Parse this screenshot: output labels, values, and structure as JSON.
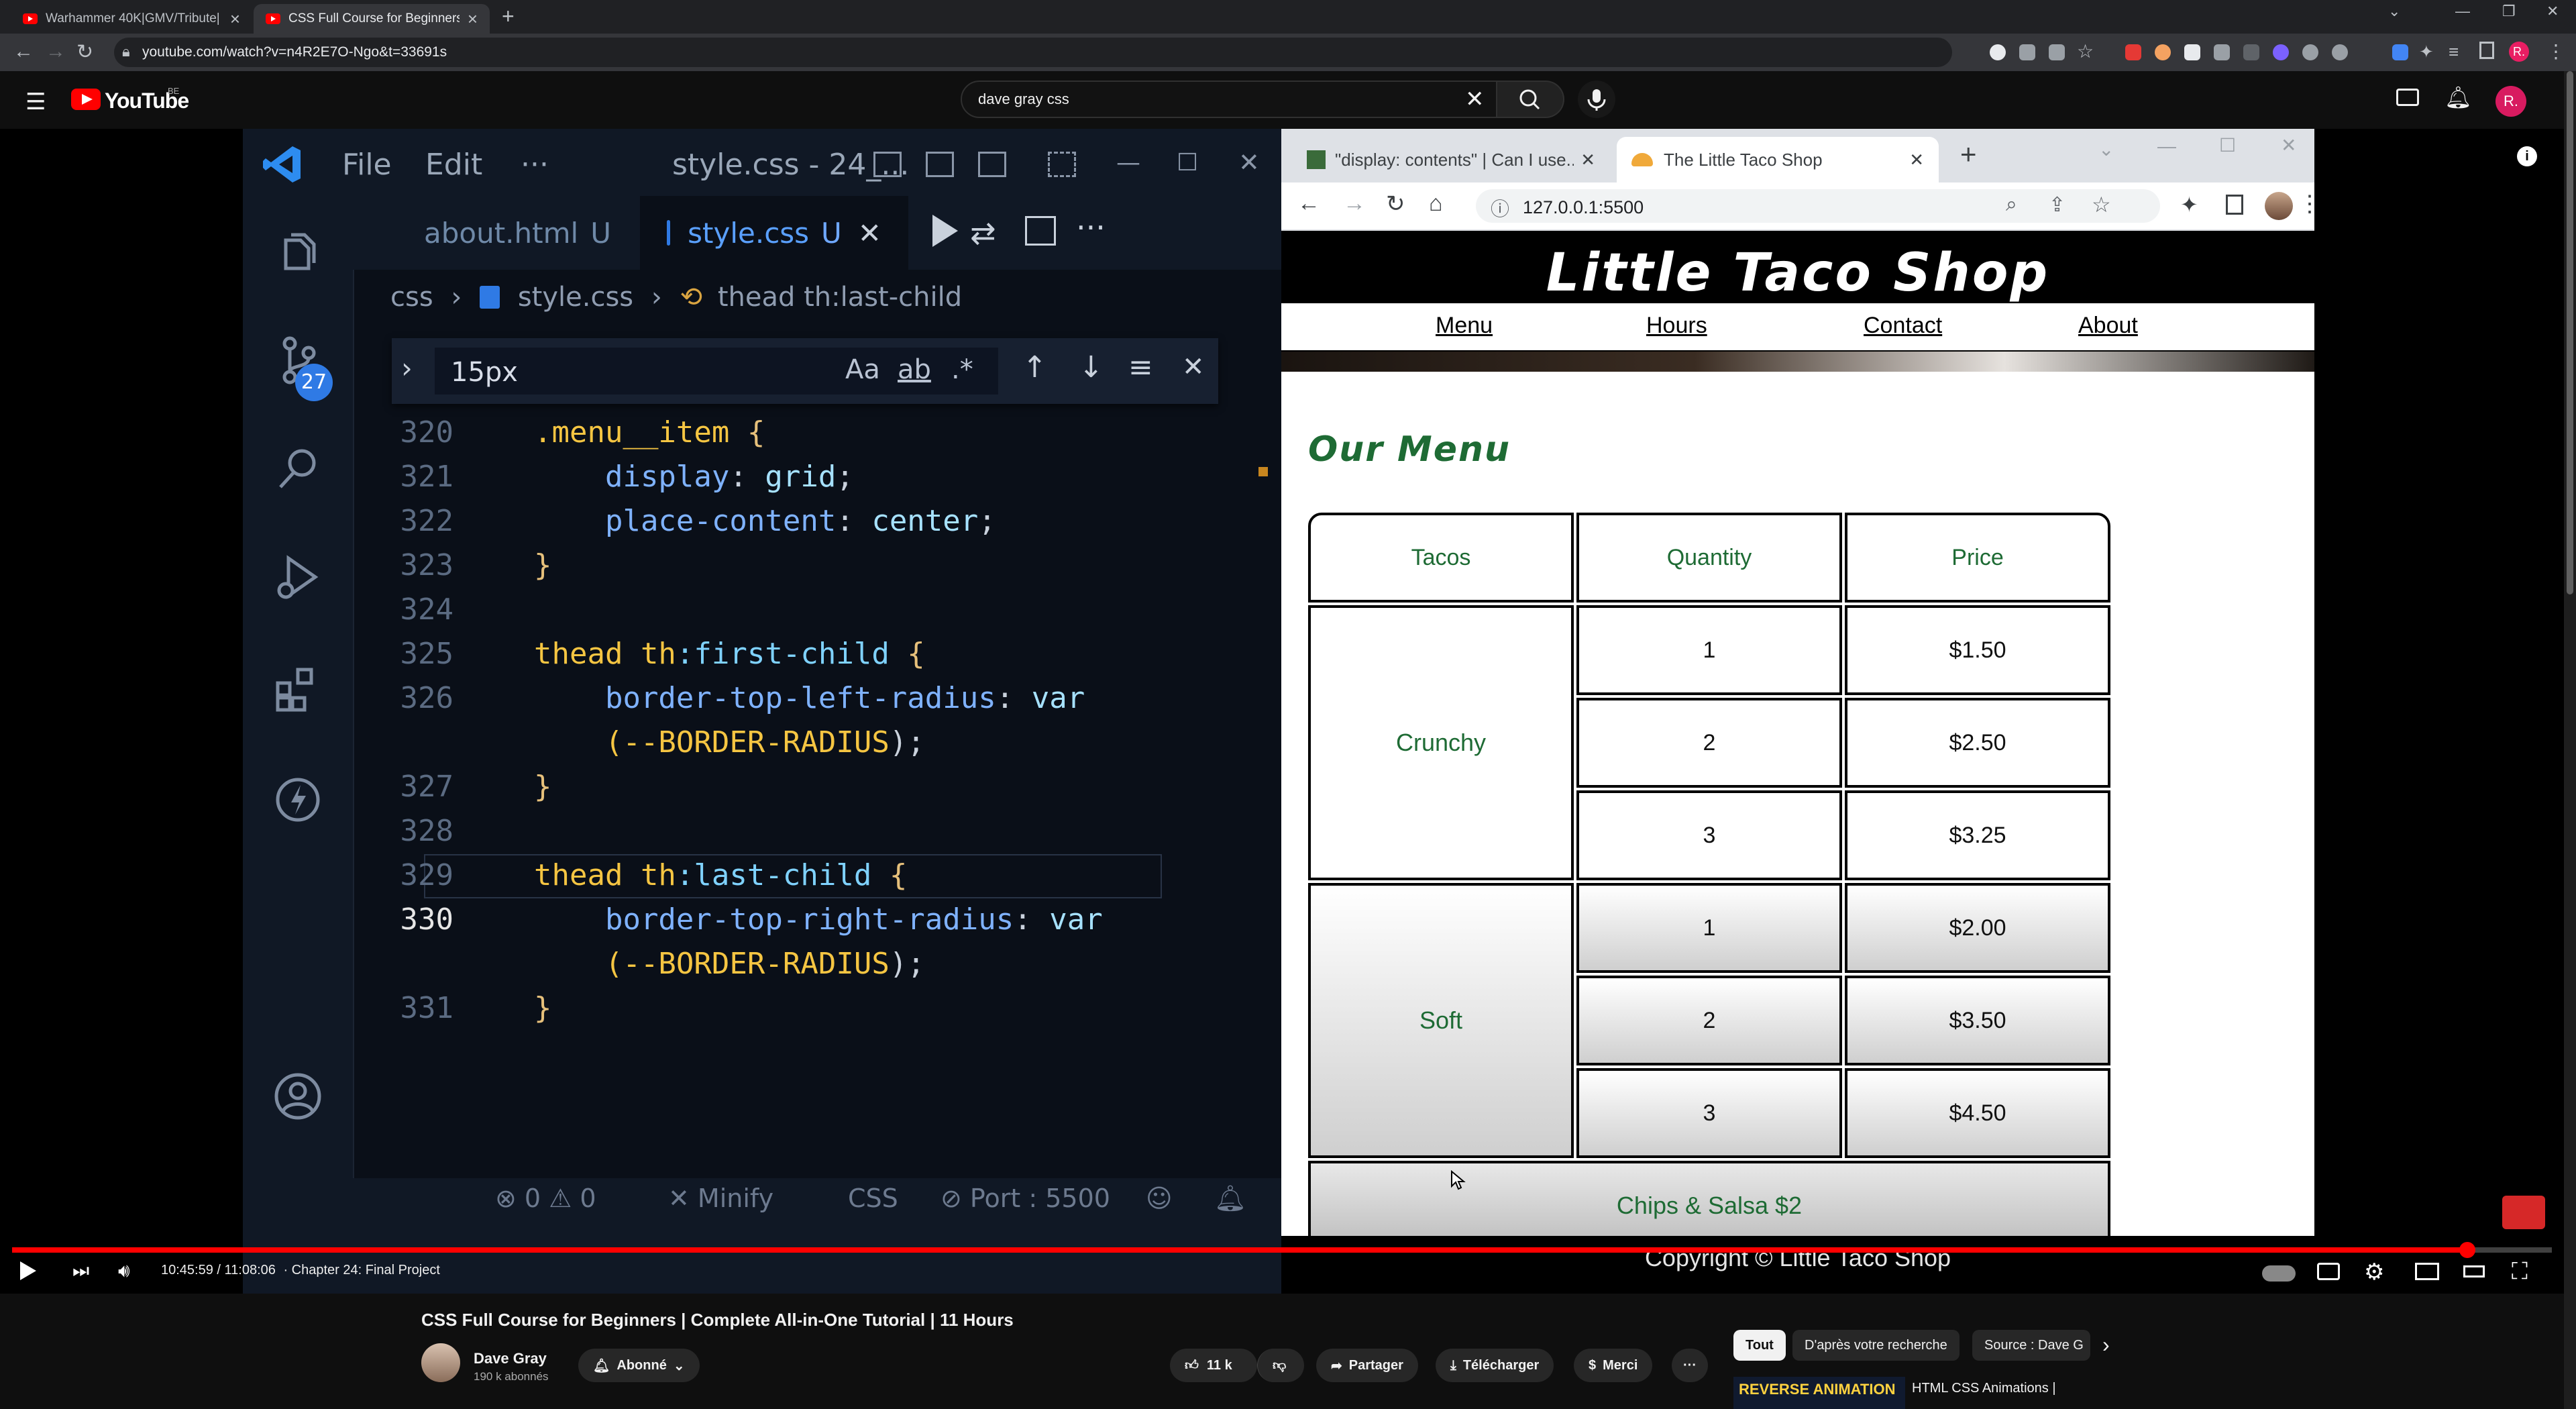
{
  "chrome": {
    "tabs": [
      {
        "title": "Warhammer 40K|GMV/Tribute|"
      },
      {
        "title": "CSS Full Course for Beginners | C"
      }
    ],
    "new_tab": "+",
    "url": "youtube.com/watch?v=n4R2E7O-Ngo&t=33691s",
    "profile_letter": "R."
  },
  "youtube": {
    "logo_text": "YouTube",
    "country": "BE",
    "search_value": "dave gray css",
    "profile_letter": "R."
  },
  "vscode": {
    "menu": [
      "File",
      "Edit",
      "···"
    ],
    "title": "style.css - 24_...",
    "scm_badge": "27",
    "tabs": [
      {
        "name": "about.html",
        "status": "U"
      },
      {
        "name": "style.css",
        "status": "U"
      }
    ],
    "breadcrumb": [
      "css",
      "style.css",
      "thead th:last-child"
    ],
    "find": {
      "value": "15px",
      "case": "Aa",
      "word": "ab",
      "regex": ".*"
    },
    "lines": [
      {
        "n": "320",
        "code": [
          [
            ".menu__item",
            "sel"
          ],
          [
            " {",
            "brace"
          ]
        ]
      },
      {
        "n": "321",
        "code": [
          [
            "    display",
            "prop"
          ],
          [
            ": ",
            "plain"
          ],
          [
            "grid",
            "val"
          ],
          [
            ";",
            "plain"
          ]
        ]
      },
      {
        "n": "322",
        "code": [
          [
            "    place-content",
            "prop"
          ],
          [
            ": ",
            "plain"
          ],
          [
            "center",
            "val"
          ],
          [
            ";",
            "plain"
          ]
        ]
      },
      {
        "n": "323",
        "code": [
          [
            "}",
            "brace"
          ]
        ]
      },
      {
        "n": "324",
        "code": []
      },
      {
        "n": "325",
        "code": [
          [
            "thead th",
            "sel"
          ],
          [
            ":first-child",
            "pseudo"
          ],
          [
            " {",
            "brace"
          ]
        ]
      },
      {
        "n": "326",
        "code": [
          [
            "    border-top-left-radius",
            "prop"
          ],
          [
            ": ",
            "plain"
          ],
          [
            "var",
            "val"
          ]
        ]
      },
      {
        "n": "",
        "code": [
          [
            "    (--BORDER-RADIUS",
            "sel"
          ],
          [
            ");",
            "plain"
          ]
        ]
      },
      {
        "n": "327",
        "code": [
          [
            "}",
            "brace"
          ]
        ]
      },
      {
        "n": "328",
        "code": []
      },
      {
        "n": "329",
        "code": [
          [
            "thead th",
            "sel"
          ],
          [
            ":last-child",
            "pseudo"
          ],
          [
            " {",
            "brace"
          ]
        ]
      },
      {
        "n": "330",
        "code": [
          [
            "    border-top-right-radius",
            "prop"
          ],
          [
            ": ",
            "plain"
          ],
          [
            "var",
            "val"
          ]
        ]
      },
      {
        "n": "",
        "code": [
          [
            "    (--BORDER-RADIUS",
            "sel"
          ],
          [
            ");",
            "plain"
          ]
        ]
      },
      {
        "n": "331",
        "code": [
          [
            "}",
            "brace"
          ]
        ]
      }
    ],
    "status": {
      "errors": "0",
      "warnings": "0",
      "minify": "Minify",
      "lang": "CSS",
      "port": "Port : 5500"
    }
  },
  "preview": {
    "tabs": [
      {
        "title": "\"display: contents\" | Can I use... S"
      },
      {
        "title": "The Little Taco Shop"
      }
    ],
    "url": "127.0.0.1:5500",
    "site_title": "Little Taco Shop",
    "nav": [
      "Menu",
      "Hours",
      "Contact",
      "About"
    ],
    "menu_heading": "Our Menu",
    "table": {
      "headers": [
        "Tacos",
        "Quantity",
        "Price"
      ],
      "groups": [
        {
          "name": "Crunchy",
          "rows": [
            [
              "1",
              "$1.50"
            ],
            [
              "2",
              "$2.50"
            ],
            [
              "3",
              "$3.25"
            ]
          ]
        },
        {
          "name": "Soft",
          "rows": [
            [
              "1",
              "$2.00"
            ],
            [
              "2",
              "$3.50"
            ],
            [
              "3",
              "$4.50"
            ]
          ]
        }
      ],
      "footer": "Chips & Salsa $2"
    },
    "copyright": "Copyright © Little Taco Shop"
  },
  "player": {
    "time": "10:45:59 / 11:08:06",
    "chapter": "· Chapter 24: Final Project",
    "progress": 0.9667
  },
  "video": {
    "title": "CSS Full Course for Beginners | Complete All-in-One Tutorial | 11 Hours",
    "channel": "Dave Gray",
    "subscribers": "190 k abonnés",
    "subscribe": "Abonné",
    "likes": "11 k",
    "share": "Partager",
    "download": "Télécharger",
    "thanks": "Merci",
    "more": "···"
  },
  "recommendations": {
    "chips": [
      "Tout",
      "D'après votre recherche",
      "Source : Dave G"
    ],
    "first_thumb": "REVERSE ANIMATION",
    "first_title": "HTML CSS Animations |"
  }
}
